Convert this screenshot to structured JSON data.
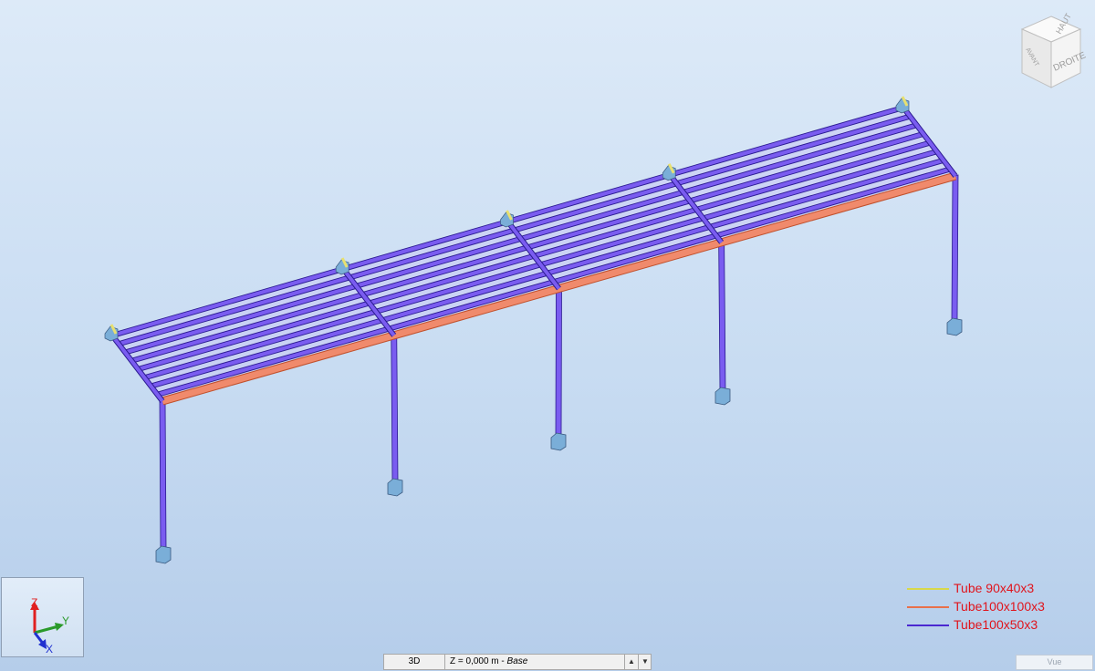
{
  "view_cube": {
    "top_label": "HAUT",
    "right_label": "DROITE",
    "left_label": "AVANT"
  },
  "axes": {
    "z_label": "Z",
    "y_label": "Y",
    "x_label": "X"
  },
  "legend": {
    "items": [
      {
        "label": "Tube 90x40x3",
        "color": "#d8d84a"
      },
      {
        "label": "Tube100x100x3",
        "color": "#e8704a"
      },
      {
        "label": "Tube100x50x3",
        "color": "#4a28d0"
      }
    ]
  },
  "status_bar": {
    "view_mode": "3D",
    "level_value": "Z = 0,000 m",
    "level_separator": " - ",
    "level_name": "Base",
    "up_arrow": "▲",
    "down_arrow": "▼"
  },
  "vue_button": {
    "label": "Vue"
  },
  "colors": {
    "beam": "#7a5cf0",
    "beam_dark": "#4a28d0",
    "beam_edge": "#2a1a90",
    "edge_beam": "#f08a6c",
    "support": "#e8e070",
    "footing": "#7aaed8"
  }
}
